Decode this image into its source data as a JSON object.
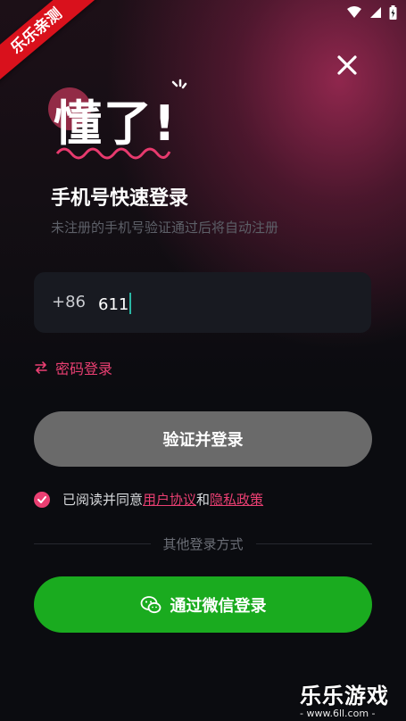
{
  "corner_badge": "乐乐亲测",
  "logo": {
    "text": "懂了!"
  },
  "header": {
    "title": "手机号快速登录",
    "subtitle": "未注册的手机号验证通过后将自动注册"
  },
  "phone": {
    "country_code": "+86",
    "value": "611"
  },
  "password_login": {
    "label": "密码登录",
    "icon": "swap-icon"
  },
  "primary_button": {
    "label": "验证并登录"
  },
  "agreement": {
    "prefix": "已阅读并同意",
    "user_agreement": "用户协议",
    "and": "和",
    "privacy_policy": "隐私政策",
    "checked": true
  },
  "divider": {
    "label": "其他登录方式"
  },
  "wechat_button": {
    "label": "通过微信登录",
    "icon": "wechat-icon"
  },
  "watermark": {
    "title": "乐乐游戏",
    "url": "- www.6ll.com -"
  },
  "colors": {
    "accent": "#ea3f72",
    "wechat_green": "#1aab1f",
    "button_gray": "#6a6a6a",
    "background": "#0b0c10"
  }
}
